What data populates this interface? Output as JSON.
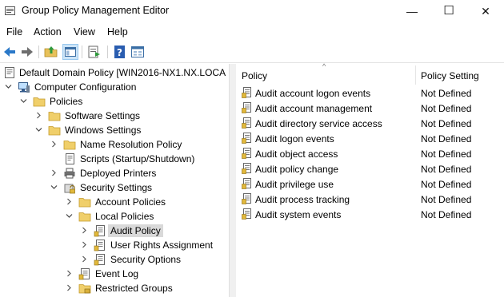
{
  "window": {
    "title": "Group Policy Management Editor",
    "minimize_glyph": "—",
    "maximize_glyph": "☐",
    "close_glyph": "✕"
  },
  "menu": [
    "File",
    "Action",
    "View",
    "Help"
  ],
  "toolbar": {
    "buttons": [
      "back-icon",
      "forward-icon",
      "up-folder-icon",
      "show-hide-tree-icon",
      "export-list-icon",
      "help-icon",
      "properties-icon"
    ]
  },
  "tree": {
    "root": "Default Domain Policy [WIN2016-NX1.NX.LOCA",
    "computer_configuration": "Computer Configuration",
    "policies": "Policies",
    "software_settings": "Software Settings",
    "windows_settings": "Windows Settings",
    "name_resolution_policy": "Name Resolution Policy",
    "scripts": "Scripts (Startup/Shutdown)",
    "deployed_printers": "Deployed Printers",
    "security_settings": "Security Settings",
    "account_policies": "Account Policies",
    "local_policies": "Local Policies",
    "audit_policy": "Audit Policy",
    "user_rights_assignment": "User Rights Assignment",
    "security_options": "Security Options",
    "event_log": "Event Log",
    "restricted_groups": "Restricted Groups"
  },
  "list": {
    "columns": [
      "Policy",
      "Policy Setting"
    ],
    "rows": [
      {
        "policy": "Audit account logon events",
        "setting": "Not Defined"
      },
      {
        "policy": "Audit account management",
        "setting": "Not Defined"
      },
      {
        "policy": "Audit directory service access",
        "setting": "Not Defined"
      },
      {
        "policy": "Audit logon events",
        "setting": "Not Defined"
      },
      {
        "policy": "Audit object access",
        "setting": "Not Defined"
      },
      {
        "policy": "Audit policy change",
        "setting": "Not Defined"
      },
      {
        "policy": "Audit privilege use",
        "setting": "Not Defined"
      },
      {
        "policy": "Audit process tracking",
        "setting": "Not Defined"
      },
      {
        "policy": "Audit system events",
        "setting": "Not Defined"
      }
    ]
  },
  "colors": {
    "selection": "#d9d9d9",
    "folder": "#e8c15a",
    "toolbar_active": "#cce4f7"
  }
}
